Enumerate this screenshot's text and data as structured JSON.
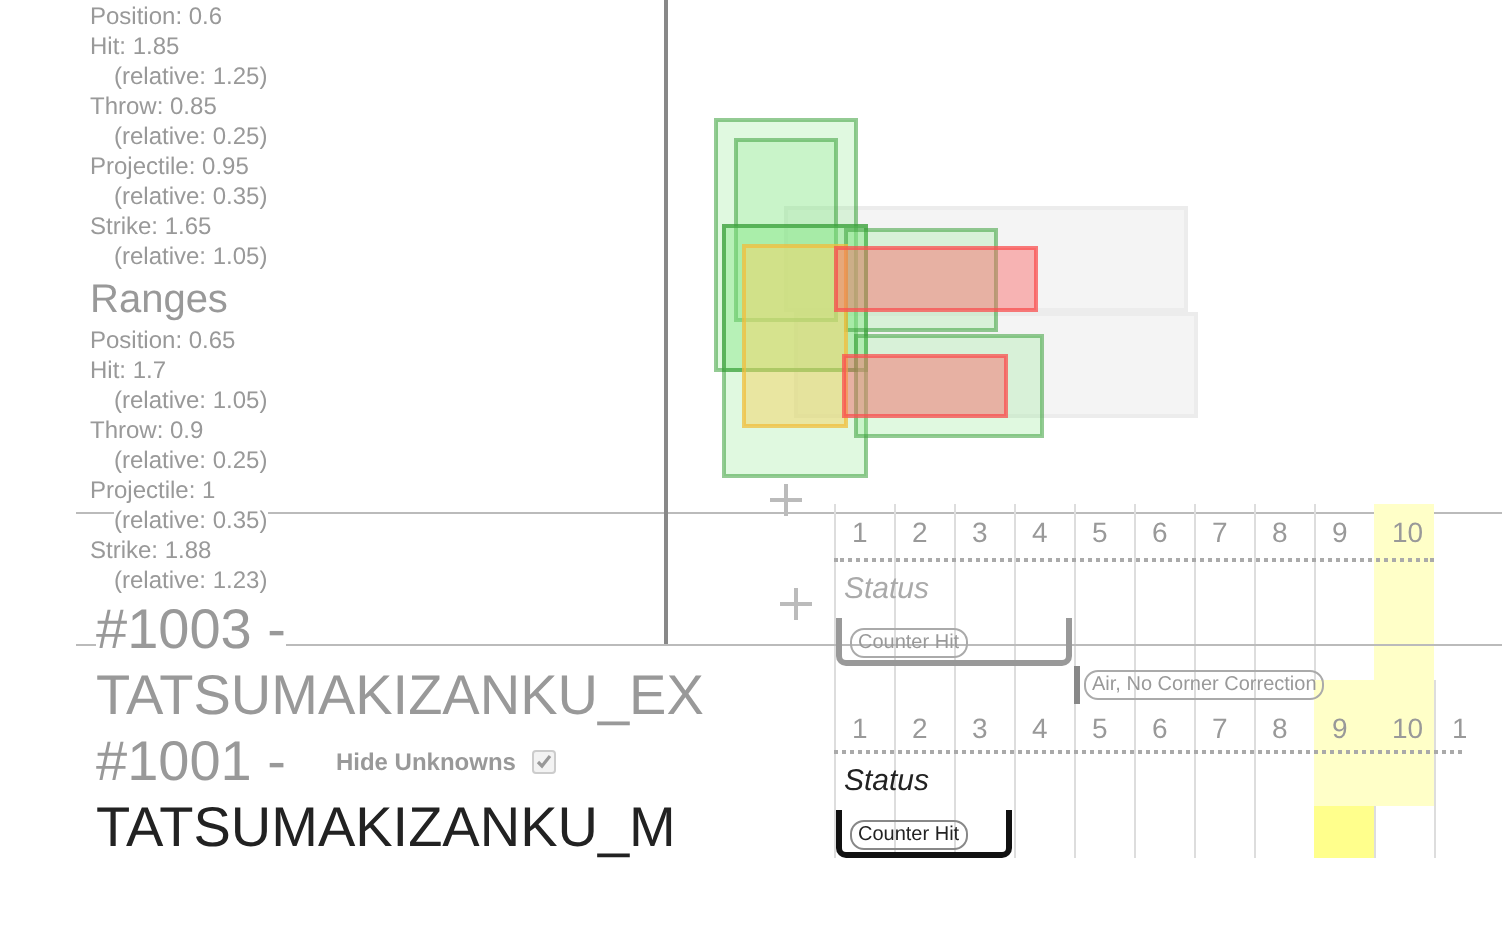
{
  "layers": [
    {
      "kind": "outgoing",
      "ranges": {
        "entries": [
          {
            "kind": "value",
            "text": "Position: 0.6"
          },
          {
            "kind": "value",
            "text": "Hit: 1.85"
          },
          {
            "kind": "relative",
            "text": "(relative: 1.25)"
          },
          {
            "kind": "value",
            "text": "Throw: 0.85"
          },
          {
            "kind": "relative",
            "text": "(relative: 0.25)"
          },
          {
            "kind": "value",
            "text": "Projectile: 0.95"
          },
          {
            "kind": "relative",
            "text": "(relative: 0.35)"
          },
          {
            "kind": "value",
            "text": "Strike: 1.65"
          },
          {
            "kind": "relative",
            "text": "(relative: 1.05)"
          }
        ]
      },
      "title": {
        "number": "#1003 -",
        "name": "TATSUMAKIZANKU_EX"
      },
      "frames": [
        {
          "label": "1",
          "selected": false,
          "current": false,
          "in_status_bracket": true
        },
        {
          "label": "2",
          "selected": false,
          "current": false,
          "in_status_bracket": true
        },
        {
          "label": "3",
          "selected": false,
          "current": false,
          "in_status_bracket": true
        },
        {
          "label": "4",
          "selected": false,
          "current": false,
          "in_status_bracket": true
        },
        {
          "label": "5",
          "selected": false,
          "current": false,
          "marker": true
        },
        {
          "label": "6",
          "selected": false,
          "current": false
        },
        {
          "label": "7",
          "selected": false,
          "current": false
        },
        {
          "label": "8",
          "selected": false,
          "current": false
        },
        {
          "label": "9",
          "selected": false,
          "current": false
        },
        {
          "label": "10",
          "selected": true,
          "current": false
        }
      ],
      "status_label": "Status",
      "status_tag": "Counter Hit",
      "marker_tag": "Air, No Corner Correction"
    },
    {
      "kind": "current",
      "ranges": {
        "heading": "Ranges",
        "entries": [
          {
            "kind": "value",
            "text": "Position: 0.65"
          },
          {
            "kind": "value",
            "text": "Hit: 1.7"
          },
          {
            "kind": "relative",
            "text": "(relative: 1.05)"
          },
          {
            "kind": "value",
            "text": "Throw: 0.9"
          },
          {
            "kind": "relative",
            "text": "(relative: 0.25)"
          },
          {
            "kind": "value",
            "text": "Projectile: 1"
          },
          {
            "kind": "relative",
            "text": "(relative: 0.35)"
          },
          {
            "kind": "value",
            "text": "Strike: 1.88"
          },
          {
            "kind": "relative",
            "text": "(relative: 1.23)"
          }
        ]
      },
      "title": {
        "number": "#1001 -",
        "name": "TATSUMAKIZANKU_M"
      },
      "hide_unknowns": {
        "label": "Hide Unknowns",
        "checked": true
      },
      "frames": [
        {
          "label": "1",
          "selected": false,
          "current": false,
          "in_status_bracket": true
        },
        {
          "label": "2",
          "selected": false,
          "current": false,
          "in_status_bracket": true
        },
        {
          "label": "3",
          "selected": false,
          "current": false,
          "in_status_bracket": true
        },
        {
          "label": "4",
          "selected": false,
          "current": false
        },
        {
          "label": "5",
          "selected": false,
          "current": false
        },
        {
          "label": "6",
          "selected": false,
          "current": false
        },
        {
          "label": "7",
          "selected": false,
          "current": false
        },
        {
          "label": "8",
          "selected": false,
          "current": false
        },
        {
          "label": "9",
          "selected": true,
          "current": true
        },
        {
          "label": "10",
          "selected": true,
          "current": false
        },
        {
          "label": "1",
          "selected": false,
          "current": false
        }
      ],
      "status_label": "Status",
      "status_tag": "Counter Hit"
    }
  ]
}
